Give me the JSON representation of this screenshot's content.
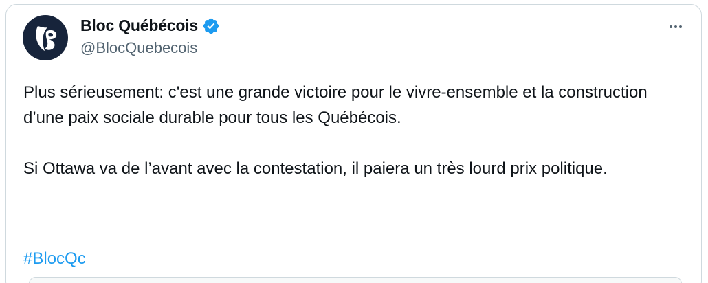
{
  "author": {
    "display_name": "Bloc Québécois",
    "handle": "@BlocQuebecois",
    "verified": true,
    "avatar_icon": "bloc-quebecois-logo-icon",
    "avatar_bg": "#17243b"
  },
  "tweet": {
    "paragraph1": "Plus sérieusement: c'est une grande victoire pour le vivre-ensemble et la construction d’une paix sociale durable pour tous les Québécois.",
    "paragraph2": "Si Ottawa va de l’avant avec la contestation, il paiera un très lourd prix politique.",
    "hashtag": "#BlocQc"
  },
  "icons": {
    "verified": "verified-badge-icon",
    "more": "more-options-icon"
  },
  "colors": {
    "text": "#0f1419",
    "secondary": "#536471",
    "link": "#1d9bf0",
    "verified": "#1d9bf0",
    "border": "#cfd9de"
  }
}
